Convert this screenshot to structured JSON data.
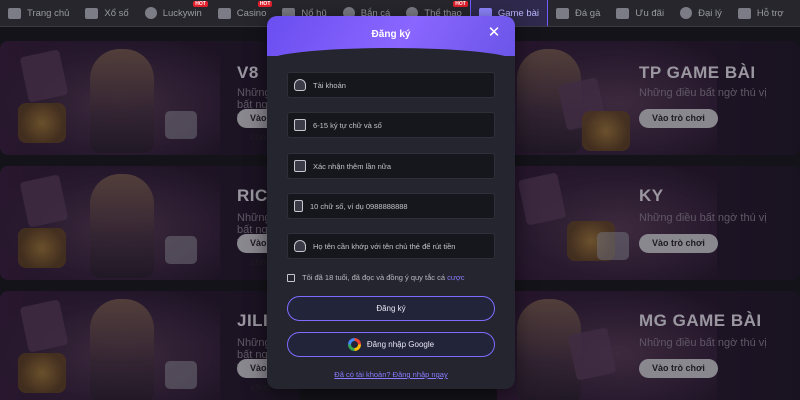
{
  "nav": {
    "items": [
      {
        "label": "Trang chủ",
        "icon": "home-icon",
        "hot": ""
      },
      {
        "label": "Xổ số",
        "icon": "lottery-icon",
        "hot": ""
      },
      {
        "label": "Luckywin",
        "icon": "soccer-icon",
        "hot": "HOT"
      },
      {
        "label": "Casino",
        "icon": "casino-icon",
        "hot": "HOT"
      },
      {
        "label": "Nổ hũ",
        "icon": "slot-icon",
        "hot": ""
      },
      {
        "label": "Bắn cá",
        "icon": "fish-icon",
        "hot": ""
      },
      {
        "label": "Thể thao",
        "icon": "sports-icon",
        "hot": "HOT"
      },
      {
        "label": "Game bài",
        "icon": "cards-icon",
        "hot": ""
      },
      {
        "label": "Đá gà",
        "icon": "rooster-icon",
        "hot": ""
      },
      {
        "label": "Ưu đãi",
        "icon": "gift-icon",
        "hot": ""
      },
      {
        "label": "Đại lý",
        "icon": "agent-icon",
        "hot": ""
      },
      {
        "label": "Hỗ trợ",
        "icon": "support-icon",
        "hot": ""
      }
    ],
    "active": "Game bài"
  },
  "cards": {
    "left": [
      {
        "title": "V8",
        "subtitle": "Những điều bất ngờ thú vị",
        "button": "Vào trò chơi"
      },
      {
        "title": "RICH",
        "subtitle": "Những điều bất ngờ thú vị",
        "button": "Vào trò chơi"
      },
      {
        "title": "JILI",
        "subtitle": "Những điều bất ngờ thú vị",
        "button": "Vào trò chơi"
      }
    ],
    "right": [
      {
        "title": "TP GAME BÀI",
        "subtitle": "Những điều bất ngờ thú vị",
        "button": "Vào trò chơi"
      },
      {
        "title": "KY",
        "subtitle": "Những điều bất ngờ thú vị",
        "button": "Vào trò chơi"
      },
      {
        "title": "MG GAME BÀI",
        "subtitle": "Những điều bất ngờ thú vị",
        "button": "Vào trò chơi"
      }
    ]
  },
  "modal": {
    "title": "Đăng ký",
    "fields": [
      {
        "placeholder": "Tài khoản",
        "icon": "user-icon"
      },
      {
        "placeholder": "6-15 ký tự chữ và số",
        "icon": "lock-icon"
      },
      {
        "placeholder": "Xác nhận thêm lần nữa",
        "icon": "lock-icon"
      },
      {
        "placeholder": "10 chữ số, ví dụ 0988888888",
        "icon": "phone-icon"
      },
      {
        "placeholder": "Họ tên cần khớp với tên chủ thẻ để rút tiền",
        "icon": "user-icon"
      }
    ],
    "terms_text": "Tôi đã 18 tuổi, đã đọc và đồng ý quy tắc cá",
    "terms_link": "cược",
    "register_button": "Đăng ký",
    "google_button": "Đăng nhập Google",
    "login_link": "Đã có tài khoản? Đăng nhập ngay"
  },
  "colors": {
    "accent": "#7d6cff",
    "modal_bg": "#24252e",
    "nav_bg": "#26262c"
  }
}
